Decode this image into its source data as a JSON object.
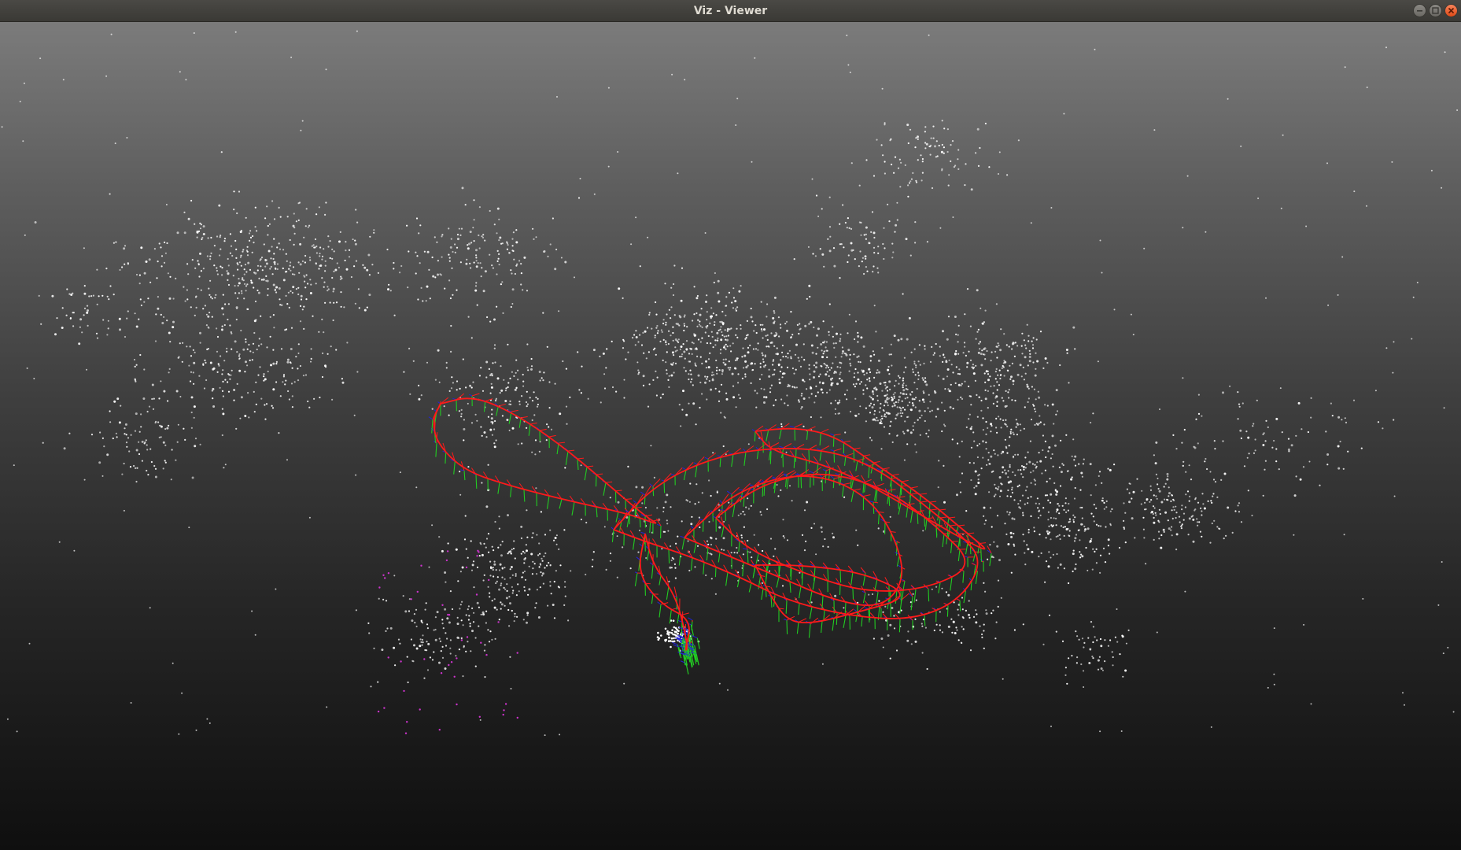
{
  "window": {
    "title": "Viz - Viewer",
    "controls": [
      "minimize",
      "maximize",
      "close"
    ]
  },
  "scene": {
    "background_colors": [
      "#7b7b7b",
      "#0f0f0f"
    ],
    "point_cloud_color": "#ffffff",
    "trajectory_color": "#ff1a1a",
    "axis_colors": {
      "x": "#ff1a1a",
      "y": "#22cc22",
      "z": "#2222dd"
    },
    "highlight_point_color": "#cc33cc"
  }
}
